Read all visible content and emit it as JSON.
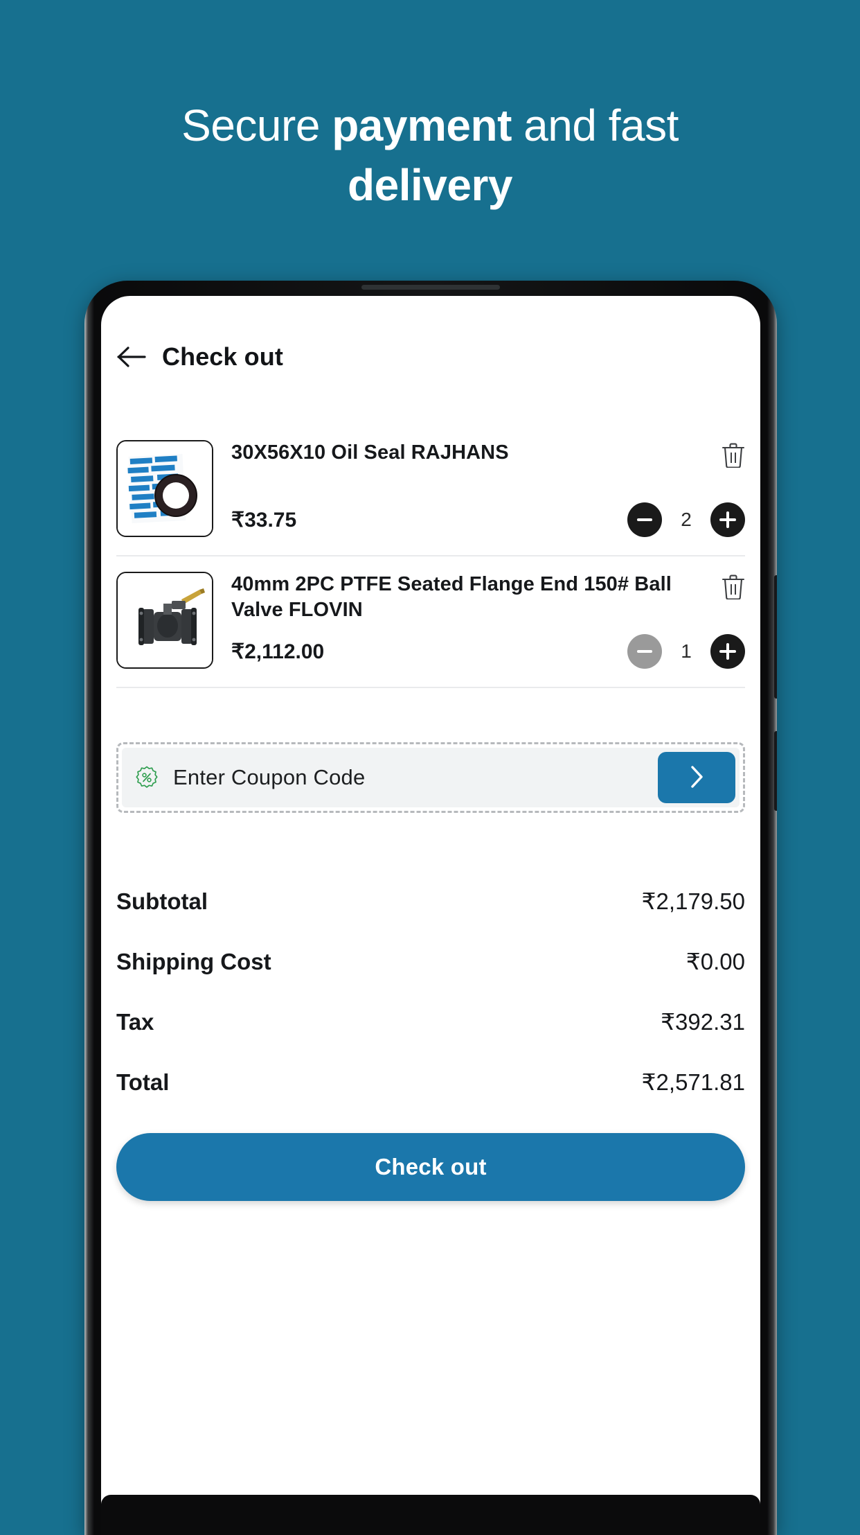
{
  "promo": {
    "line1_pre": "Secure ",
    "line1_bold": "payment",
    "line1_post": " and fast",
    "line2": "delivery"
  },
  "colors": {
    "background": "#17708f",
    "accent": "#1b77ab",
    "text": "#16181b",
    "coupon_bg": "#f1f3f4",
    "disabled": "#9a9a9a"
  },
  "app": {
    "header": {
      "title": "Check out",
      "back_icon": "arrow-left-icon"
    },
    "cart": {
      "items": [
        {
          "name": "30X56X10 Oil Seal RAJHANS",
          "price": "₹33.75",
          "quantity": "2",
          "decrement_label": "−",
          "increment_label": "+",
          "decrement_enabled": true,
          "delete_icon": "trash-icon",
          "image_alt": "oil-seal-product-image"
        },
        {
          "name": "40mm 2PC PTFE Seated Flange End 150# Ball Valve FLOVIN",
          "price": "₹2,112.00",
          "quantity": "1",
          "decrement_label": "−",
          "increment_label": "+",
          "decrement_enabled": false,
          "delete_icon": "trash-icon",
          "image_alt": "ball-valve-product-image"
        }
      ]
    },
    "coupon": {
      "icon": "discount-badge-icon",
      "placeholder": "Enter Coupon Code",
      "value": "",
      "submit_icon": "chevron-right-icon"
    },
    "summary": {
      "rows": [
        {
          "label": "Subtotal",
          "value": "₹2,179.50"
        },
        {
          "label": "Shipping Cost",
          "value": "₹0.00"
        },
        {
          "label": "Tax",
          "value": "₹392.31"
        },
        {
          "label": "Total",
          "value": "₹2,571.81"
        }
      ]
    },
    "cta": {
      "label": "Check out"
    }
  }
}
